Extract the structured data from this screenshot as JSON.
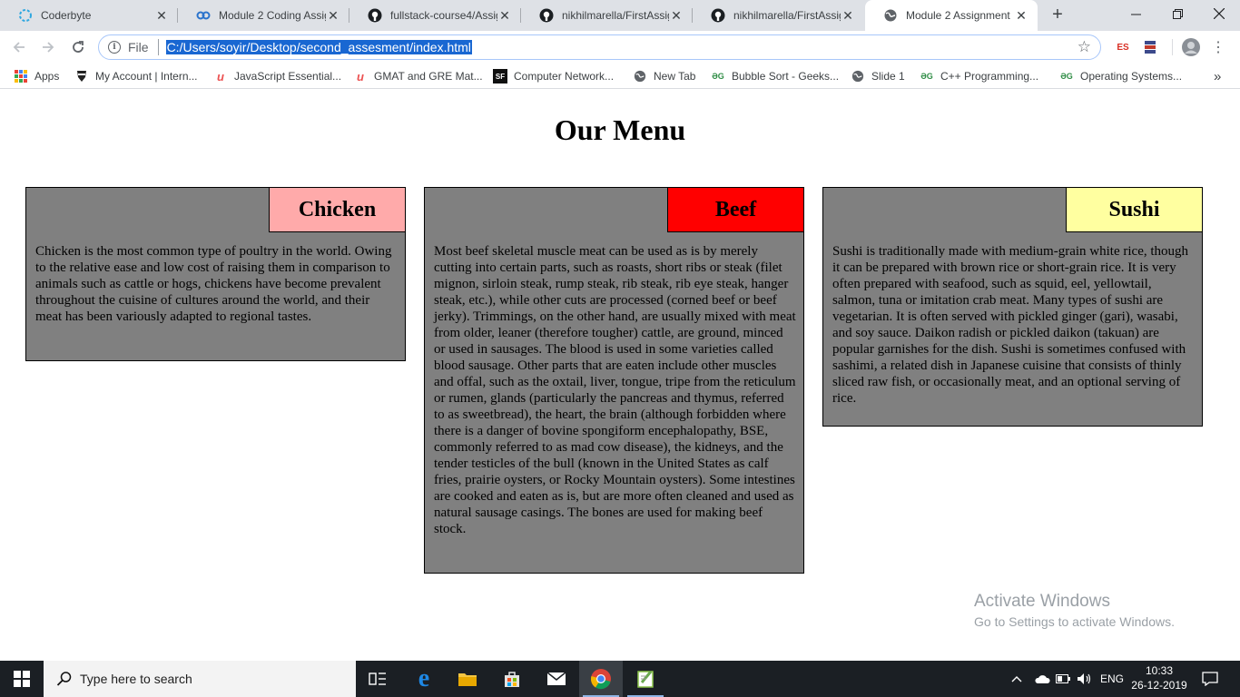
{
  "browser": {
    "tabs": [
      {
        "title": "Coderbyte",
        "icon": "coderbyte-icon",
        "active": false
      },
      {
        "title": "Module 2 Coding Assig",
        "icon": "coursera-icon",
        "active": false
      },
      {
        "title": "fullstack-course4/Assig",
        "icon": "github-icon",
        "active": false
      },
      {
        "title": "nikhilmarella/FirstAssig",
        "icon": "github-icon",
        "active": false
      },
      {
        "title": "nikhilmarella/FirstAssig",
        "icon": "github-icon",
        "active": false
      },
      {
        "title": "Module 2 Assignment",
        "icon": "globe-icon",
        "active": true
      }
    ],
    "new_tab_label": "+",
    "address": {
      "scheme_label": "File",
      "url": "C:/Users/soyir/Desktop/second_assesment/index.html"
    },
    "extensions": [
      {
        "label": "ES",
        "icon": "es-extension-icon"
      },
      {
        "label": "",
        "icon": "database-extension-icon"
      },
      {
        "label": "",
        "icon": "profile-avatar-icon"
      }
    ],
    "bookmarks": [
      {
        "label": "Apps",
        "icon": "apps-grid-icon"
      },
      {
        "label": "My Account | Intern...",
        "icon": "ninja-icon"
      },
      {
        "label": "JavaScript Essential...",
        "icon": "udemy-icon"
      },
      {
        "label": "GMAT and GRE Mat...",
        "icon": "udemy-icon"
      },
      {
        "label": "Computer Network...",
        "icon": "sf-icon"
      },
      {
        "label": "New Tab",
        "icon": "globe-icon"
      },
      {
        "label": "Bubble Sort - Geeks...",
        "icon": "gfg-icon"
      },
      {
        "label": "Slide 1",
        "icon": "globe-icon"
      },
      {
        "label": "C++ Programming...",
        "icon": "gfg-icon"
      },
      {
        "label": "Operating Systems...",
        "icon": "gfg-icon"
      }
    ],
    "more_bookmarks_label": "»"
  },
  "page": {
    "title": "Our Menu",
    "cards": [
      {
        "label": "Chicken",
        "label_color": "#ffaaaa",
        "text": "Chicken is the most common type of poultry in the world. Owing to the relative ease and low cost of raising them in comparison to animals such as cattle or hogs, chickens have become prevalent throughout the cuisine of cultures around the world, and their meat has been variously adapted to regional tastes."
      },
      {
        "label": "Beef",
        "label_color": "#ff0000",
        "text": "Most beef skeletal muscle meat can be used as is by merely cutting into certain parts, such as roasts, short ribs or steak (filet mignon, sirloin steak, rump steak, rib steak, rib eye steak, hanger steak, etc.), while other cuts are processed (corned beef or beef jerky). Trimmings, on the other hand, are usually mixed with meat from older, leaner (therefore tougher) cattle, are ground, minced or used in sausages. The blood is used in some varieties called blood sausage. Other parts that are eaten include other muscles and offal, such as the oxtail, liver, tongue, tripe from the reticulum or rumen, glands (particularly the pancreas and thymus, referred to as sweetbread), the heart, the brain (although forbidden where there is a danger of bovine spongiform encephalopathy, BSE, commonly referred to as mad cow disease), the kidneys, and the tender testicles of the bull (known in the United States as calf fries, prairie oysters, or Rocky Mountain oysters). Some intestines are cooked and eaten as is, but are more often cleaned and used as natural sausage casings. The bones are used for making beef stock."
      },
      {
        "label": "Sushi",
        "label_color": "#ffffa0",
        "text": "Sushi is traditionally made with medium-grain white rice, though it can be prepared with brown rice or short-grain rice. It is very often prepared with seafood, such as squid, eel, yellowtail, salmon, tuna or imitation crab meat. Many types of sushi are vegetarian. It is often served with pickled ginger (gari), wasabi, and soy sauce. Daikon radish or pickled daikon (takuan) are popular garnishes for the dish. Sushi is sometimes confused with sashimi, a related dish in Japanese cuisine that consists of thinly sliced raw fish, or occasionally meat, and an optional serving of rice."
      }
    ],
    "card_background": "#808080"
  },
  "watermark": {
    "line1": "Activate Windows",
    "line2": "Go to Settings to activate Windows."
  },
  "taskbar": {
    "search_placeholder": "Type here to search",
    "language": "ENG",
    "time": "10:33",
    "date": "26-12-2019"
  }
}
